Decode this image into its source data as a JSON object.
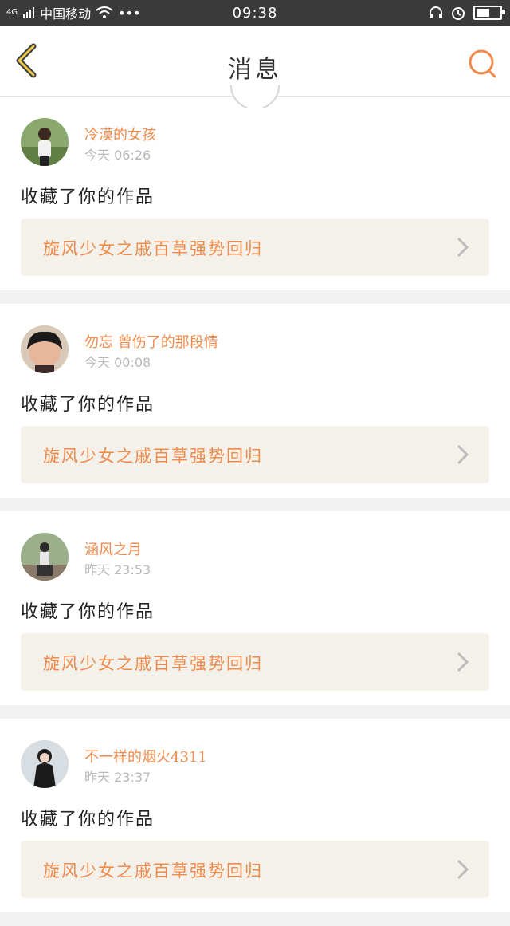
{
  "status_bar": {
    "network": "4G",
    "carrier": "中国移动",
    "dots": "•••",
    "time": "09:38"
  },
  "header": {
    "title": "消息"
  },
  "colors": {
    "accent": "#f08a4b",
    "back_icon": "#f2c94c"
  },
  "messages": [
    {
      "username": "冷漠的女孩",
      "time": "今天 06:26",
      "action": "收藏了你的作品",
      "work_title": "旋风少女之戚百草强势回归"
    },
    {
      "username": "勿忘 曾伤了的那段情",
      "time": "今天 00:08",
      "action": "收藏了你的作品",
      "work_title": "旋风少女之戚百草强势回归"
    },
    {
      "username": "涵风之月",
      "time": "昨天 23:53",
      "action": "收藏了你的作品",
      "work_title": "旋风少女之戚百草强势回归"
    },
    {
      "username": "不一样的烟火4311",
      "time": "昨天 23:37",
      "action": "收藏了你的作品",
      "work_title": "旋风少女之戚百草强势回归"
    }
  ]
}
